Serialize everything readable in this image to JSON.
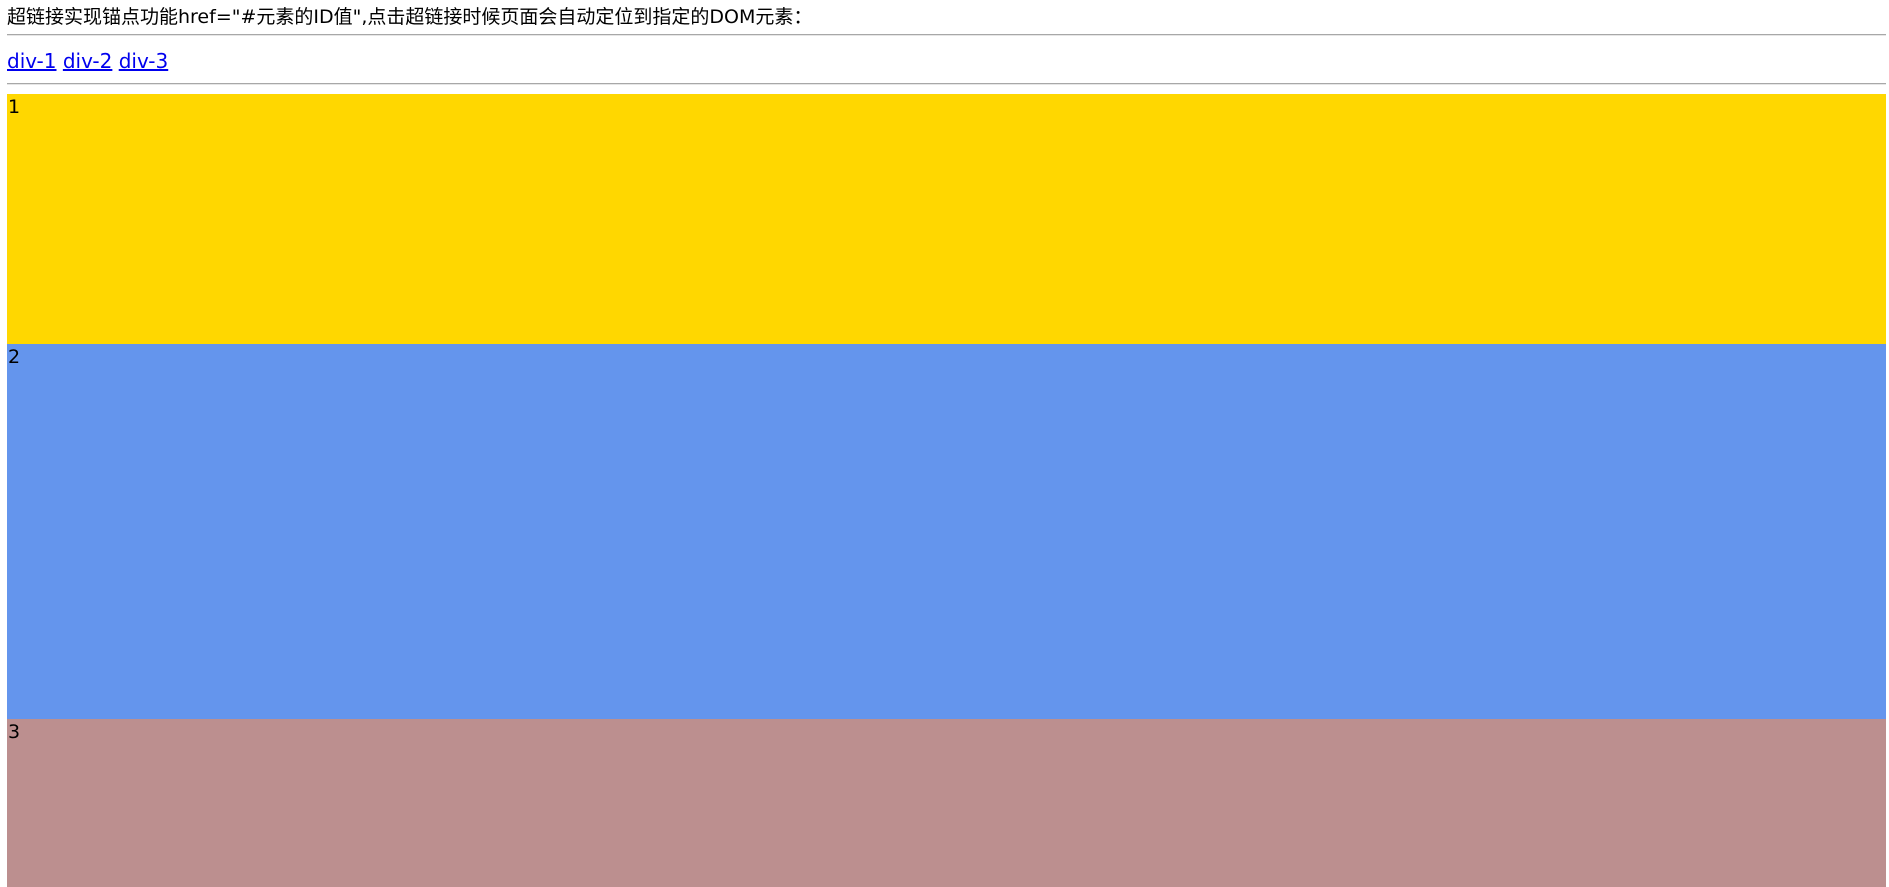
{
  "intro": {
    "text": "超链接实现锚点功能href=\"#元素的ID值\",点击超链接时候页面会自动定位到指定的DOM元素："
  },
  "links": [
    {
      "label": "div-1",
      "href": "#div-1"
    },
    {
      "label": "div-2",
      "href": "#div-2"
    },
    {
      "label": "div-3",
      "href": "#div-3"
    }
  ],
  "blocks": [
    {
      "id": "div-1",
      "label": "1",
      "color": "#FFD700"
    },
    {
      "id": "div-2",
      "label": "2",
      "color": "#6495ED"
    },
    {
      "id": "div-3",
      "label": "3",
      "color": "#BC8F8F"
    }
  ]
}
